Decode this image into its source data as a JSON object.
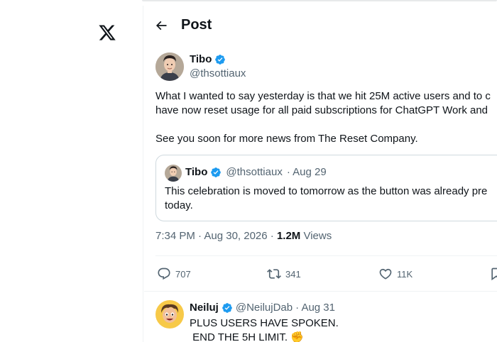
{
  "header": {
    "title": "Post"
  },
  "post": {
    "author_name": "Tibo",
    "author_handle": "@thsottiaux",
    "text": "What I wanted to say yesterday is that we hit 25M active users and to c\nhave now reset usage for all paid subscriptions for ChatGPT Work and\n\nSee you soon for more news from The Reset Company.",
    "quote": {
      "author_name": "Tibo",
      "author_handle": "@thsottiaux",
      "date": "· Aug 29",
      "text": "This celebration is moved to tomorrow as the button was already pre\ntoday."
    },
    "time": "7:34 PM · Aug 30, 2026 · ",
    "views_count": "1.2M",
    "views_label": "Views",
    "stats": {
      "replies": "707",
      "reposts": "341",
      "likes": "11K"
    }
  },
  "reply": {
    "author_name": "Neiluj",
    "author_handle": "@NeilujDab",
    "date": "· Aug 31",
    "text": "PLUS USERS HAVE SPOKEN.\n END THE 5H LIMIT. ✊"
  },
  "icons": {
    "logo": "x-logo-icon",
    "back": "arrow-left-icon",
    "verified": "verified-badge-icon",
    "reply": "reply-icon",
    "repost": "repost-icon",
    "like": "heart-icon",
    "bookmark": "bookmark-icon"
  },
  "colors": {
    "verified": "#1d9bf0",
    "muted": "#536471",
    "text": "#0f1419",
    "border": "#cfd9de"
  }
}
